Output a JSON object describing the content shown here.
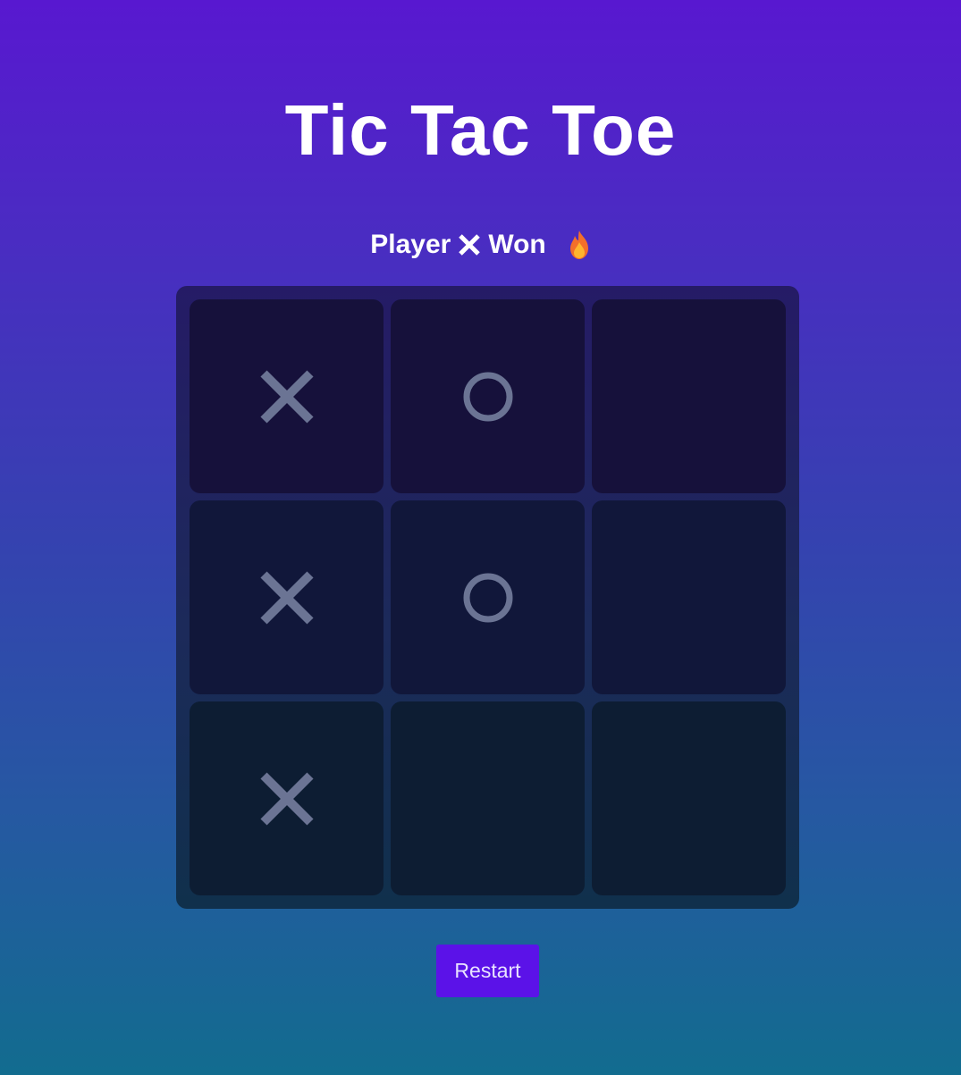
{
  "title": "Tic Tac Toe",
  "status": {
    "prefix": "Player",
    "winner_icon": "x-mark-icon",
    "suffix": "Won",
    "emoji_icon": "fire-icon"
  },
  "board": {
    "cells": [
      [
        "X",
        "O",
        ""
      ],
      [
        "X",
        "O",
        ""
      ],
      [
        "X",
        "",
        ""
      ]
    ]
  },
  "colors": {
    "mark": "#6b7494",
    "button": "#5b12e8"
  },
  "restart_label": "Restart"
}
